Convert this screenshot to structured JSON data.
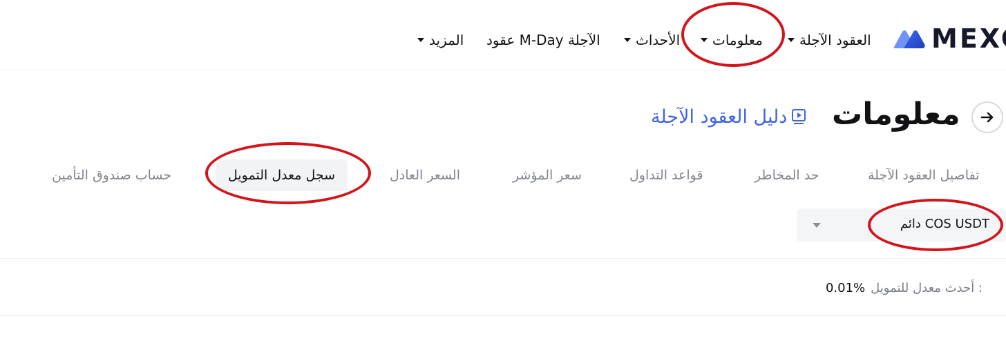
{
  "brand": {
    "name": "MEXC",
    "accent": "#3f64e6"
  },
  "nav": {
    "futures": "العقود الآجلة",
    "info": "معلومات",
    "events": "الأحداث",
    "mday": "عقود M-Day الآجلة",
    "more": "المزيد"
  },
  "header": {
    "back_icon": "arrow-right-icon",
    "title": "معلومات",
    "guide_link": "دليل العقود الآجلة"
  },
  "tabs": [
    {
      "label": "تفاصيل العقود الآجلة",
      "active": false
    },
    {
      "label": "حد المخاطر",
      "active": false
    },
    {
      "label": "قواعد التداول",
      "active": false
    },
    {
      "label": "سعر المؤشر",
      "active": false
    },
    {
      "label": "السعر العادل",
      "active": false
    },
    {
      "label": "سجل معدل التمويل",
      "active": true
    },
    {
      "label": "حساب صندوق التأمين",
      "active": false
    }
  ],
  "contract_select": {
    "value": "دائم COS USDT"
  },
  "latest_rate": {
    "label": "أحدث معدل للتمويل :",
    "value": "0.01%"
  },
  "annotation_color": "#d3141b"
}
